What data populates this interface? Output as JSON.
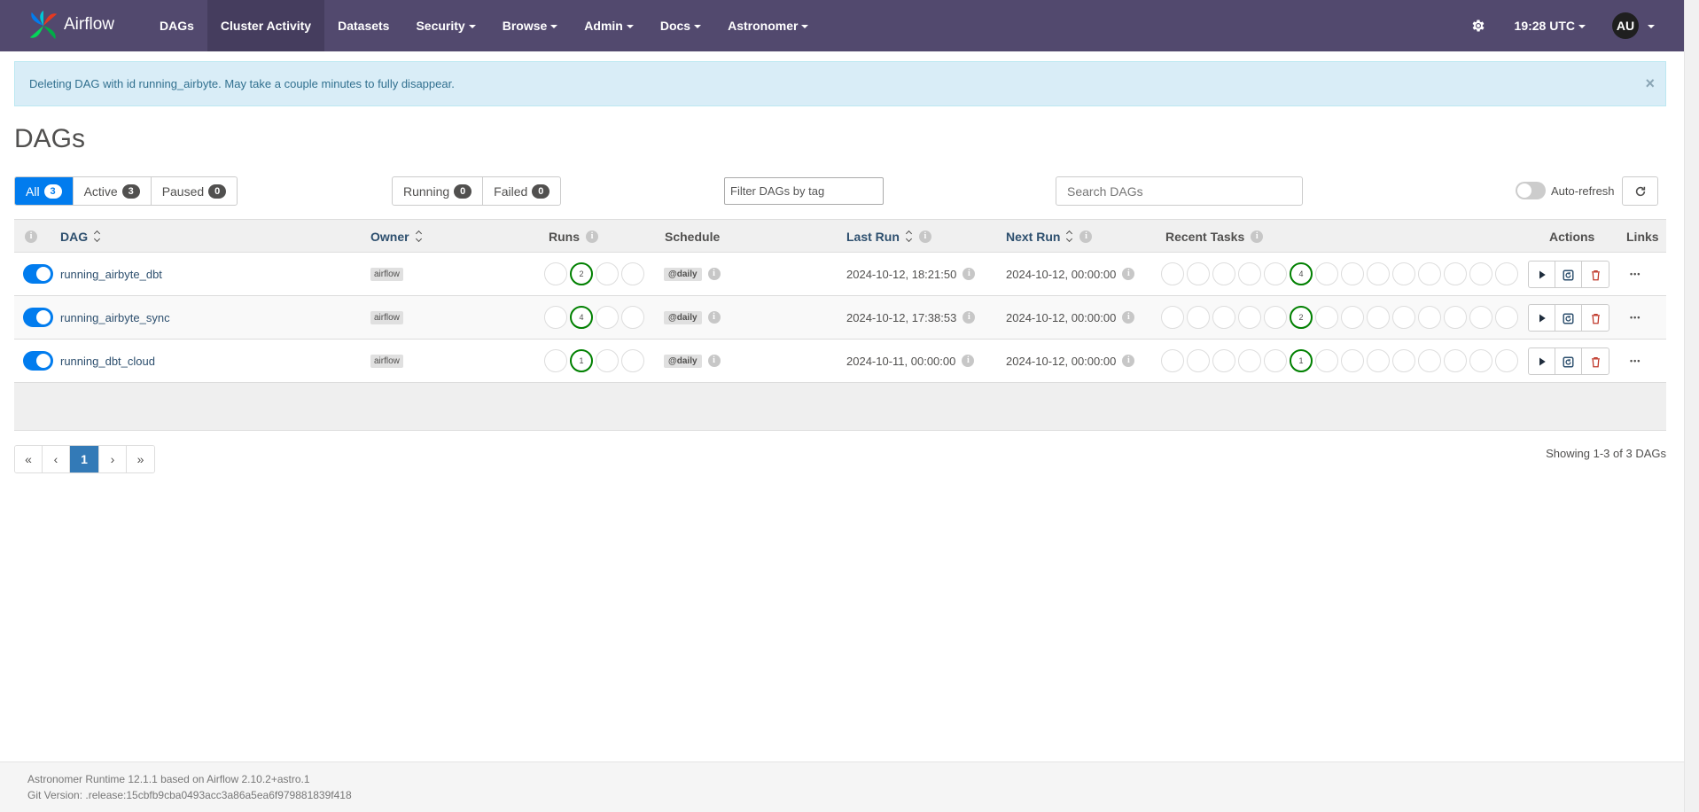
{
  "navbar": {
    "brand": "Airflow",
    "items": [
      {
        "label": "DAGs",
        "dropdown": false,
        "active": false
      },
      {
        "label": "Cluster Activity",
        "dropdown": false,
        "active": true
      },
      {
        "label": "Datasets",
        "dropdown": false,
        "active": false
      },
      {
        "label": "Security",
        "dropdown": true,
        "active": false
      },
      {
        "label": "Browse",
        "dropdown": true,
        "active": false
      },
      {
        "label": "Admin",
        "dropdown": true,
        "active": false
      },
      {
        "label": "Docs",
        "dropdown": true,
        "active": false
      },
      {
        "label": "Astronomer",
        "dropdown": true,
        "active": false
      }
    ],
    "time": "19:28 UTC",
    "user_initials": "AU",
    "bg_color": "#52496e"
  },
  "alert": {
    "message": "Deleting DAG with id running_airbyte. May take a couple minutes to fully disappear.",
    "close": "×"
  },
  "page_title": "DAGs",
  "status_filters": [
    {
      "label": "All",
      "count": "3",
      "selected": true
    },
    {
      "label": "Active",
      "count": "3",
      "selected": false
    },
    {
      "label": "Paused",
      "count": "0",
      "selected": false
    }
  ],
  "run_filters": [
    {
      "label": "Running",
      "count": "0"
    },
    {
      "label": "Failed",
      "count": "0"
    }
  ],
  "tag_filter_placeholder": "Filter DAGs by tag",
  "search_placeholder": "Search DAGs",
  "auto_refresh_label": "Auto-refresh",
  "table": {
    "headers": {
      "dag": "DAG",
      "owner": "Owner",
      "runs": "Runs",
      "schedule": "Schedule",
      "last_run": "Last Run",
      "next_run": "Next Run",
      "recent_tasks": "Recent Tasks",
      "actions": "Actions",
      "links": "Links"
    },
    "rows": [
      {
        "dag_id": "running_airbyte_dbt",
        "owner": "airflow",
        "runs_success": "2",
        "schedule": "@daily",
        "last_run": "2024-10-12, 18:21:50",
        "next_run": "2024-10-12, 00:00:00",
        "tasks_success": "4",
        "paused": false
      },
      {
        "dag_id": "running_airbyte_sync",
        "owner": "airflow",
        "runs_success": "4",
        "schedule": "@daily",
        "last_run": "2024-10-12, 17:38:53",
        "next_run": "2024-10-12, 00:00:00",
        "tasks_success": "2",
        "paused": false
      },
      {
        "dag_id": "running_dbt_cloud",
        "owner": "airflow",
        "runs_success": "1",
        "schedule": "@daily",
        "last_run": "2024-10-11, 00:00:00",
        "next_run": "2024-10-12, 00:00:00",
        "tasks_success": "1",
        "paused": false
      }
    ]
  },
  "pagination": {
    "first": "«",
    "prev": "‹",
    "current": "1",
    "next": "›",
    "last": "»",
    "showing": "Showing 1-3 of 3 DAGs"
  },
  "footer": {
    "runtime": "Astronomer Runtime 12.1.1 based on Airflow 2.10.2+astro.1",
    "git_version": "Git Version: .release:15cbfb9cba0493acc3a86a5ea6f979881839f418"
  },
  "colors": {
    "accent": "#017cee",
    "success": "#008000",
    "delete": "#c0392b",
    "link": "#2d4f6e"
  }
}
